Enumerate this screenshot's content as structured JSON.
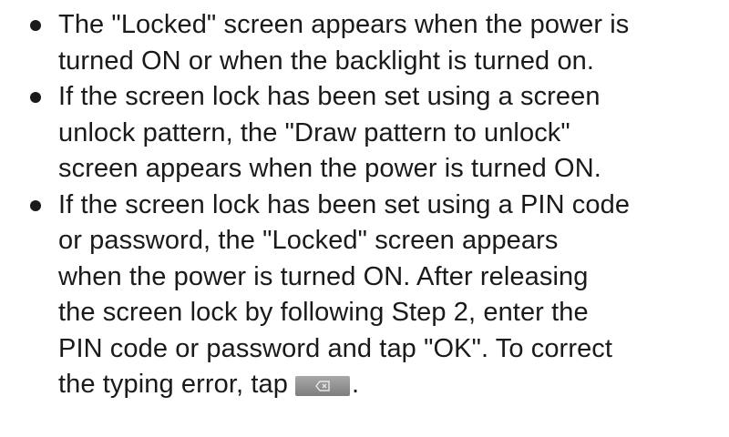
{
  "bullets": [
    {
      "lines": [
        "The \"Locked\" screen appears when the power is",
        "turned ON or when the backlight is turned on."
      ]
    },
    {
      "lines": [
        "If the screen lock has been set using a screen",
        "unlock pattern, the \"Draw pattern to unlock\"",
        "screen appears when the power is turned ON."
      ]
    },
    {
      "lines": [
        "If the screen lock has been set using a PIN code",
        "or password, the \"Locked\" screen appears",
        "when the power is turned ON. After releasing",
        "the screen lock by following Step 2, enter the",
        "PIN code or password and tap \"OK\". To correct"
      ],
      "last_line_before_icon": "the typing error, tap",
      "last_line_after_icon": ".",
      "inline_icon": "backspace-key-icon"
    }
  ],
  "colors": {
    "text": "#1a1a1a",
    "key_gradient_top": "#a9a9a9",
    "key_gradient_bottom": "#7d7d7d"
  }
}
